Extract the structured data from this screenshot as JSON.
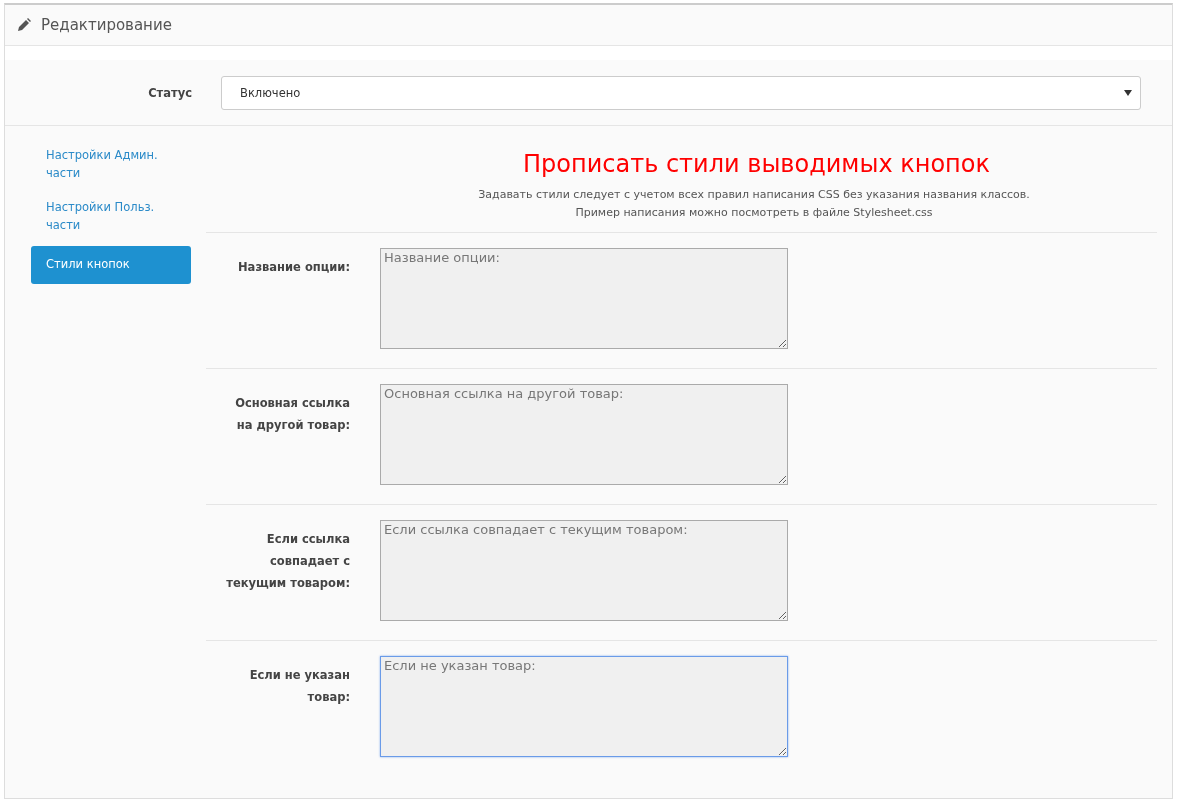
{
  "panel": {
    "title": "Редактирование"
  },
  "status": {
    "label": "Статус",
    "value": "Включено"
  },
  "sidebar": {
    "items": [
      {
        "label": "Настройки Админ. части",
        "selected": false
      },
      {
        "label": "Настройки Польз. части",
        "selected": false
      },
      {
        "label": "Стили кнопок",
        "selected": true
      }
    ]
  },
  "section": {
    "heading": "Прописать стили выводимых кнопок",
    "notes": [
      "Задавать стили следует с учетом всех правил написания CSS без указания названия классов.",
      "Пример написания можно посмотреть в файле Stylesheet.css"
    ]
  },
  "fields": [
    {
      "label": "Название опции:",
      "placeholder": "Название опции:",
      "focused": false
    },
    {
      "label": "Основная ссылка на другой товар:",
      "placeholder": "Основная ссылка на другой товар:",
      "focused": false
    },
    {
      "label": "Если ссылка совпадает с текущим товаром:",
      "placeholder": "Если ссылка совпадает с текущим товаром:",
      "focused": false
    },
    {
      "label": "Если не указан товар:",
      "placeholder": "Если не указан товар:",
      "focused": true
    }
  ]
}
